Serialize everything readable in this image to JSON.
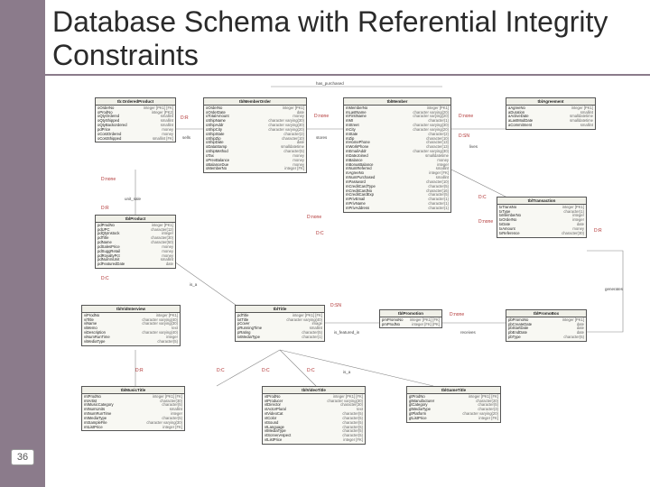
{
  "page": {
    "number": "36"
  },
  "title": "Database Schema with Referential Integrity Constraints",
  "top_rel": "has_purchased",
  "constraint_labels": [
    "D:R",
    "D:C",
    "D:SN",
    "D:none"
  ],
  "line_labels": [
    "sells",
    "is_a",
    "stores",
    "lives",
    "generates",
    "receives",
    "is_featured_in",
    "unit_sale"
  ],
  "entities": [
    {
      "name": "tb:OrderedProduct",
      "attrs": [
        [
          "oOrderNo",
          "integer [PK1] [FK]"
        ],
        [
          "oProdNo",
          "integer [PK2]"
        ],
        [
          "oQtyOrdered",
          "smallint"
        ],
        [
          "oQtyShipped",
          "smallint"
        ],
        [
          "oQtyBackordered",
          "smallint"
        ],
        [
          "pdPrice",
          "money"
        ],
        [
          "oCostOrdered",
          "money"
        ],
        [
          "oCostShipped",
          "smallint [FK]"
        ]
      ]
    },
    {
      "name": "tblMemberOrder",
      "attrs": [
        [
          "oOrderNo",
          "integer [PK1]"
        ],
        [
          "oOrderDate",
          "date"
        ],
        [
          "oTotalAmount",
          "money"
        ],
        [
          "oShipName",
          "character varying(30)"
        ],
        [
          "oShipAddr",
          "character varying(30)"
        ],
        [
          "oShipCity",
          "character varying(20)"
        ],
        [
          "oShipState",
          "character(2)"
        ],
        [
          "oShipZip",
          "character(10)"
        ],
        [
          "oShipDate",
          "date"
        ],
        [
          "oDataStamp",
          "smalldatetime"
        ],
        [
          "oShipMethod",
          "character(5)"
        ],
        [
          "oTax",
          "money"
        ],
        [
          "oPrevBalance",
          "money"
        ],
        [
          "oBalanceDue",
          "money"
        ],
        [
          "oMemberNo",
          "integer [FK]"
        ]
      ]
    },
    {
      "name": "tblMember",
      "attrs": [
        [
          "mMemberNo",
          "integer [PK1]"
        ],
        [
          "mLastName",
          "character varying(20)"
        ],
        [
          "mFirstName",
          "character varying(20)"
        ],
        [
          "mMI",
          "character(1)"
        ],
        [
          "mStreet",
          "character varying(30)"
        ],
        [
          "mCity",
          "character varying(20)"
        ],
        [
          "mState",
          "character(2)"
        ],
        [
          "mZip",
          "character(10)"
        ],
        [
          "mHomePhone",
          "character(13)"
        ],
        [
          "mWorkPhone",
          "character(13)"
        ],
        [
          "mEmailAddr",
          "character varying(30)"
        ],
        [
          "mDateJoined",
          "smalldatetime"
        ],
        [
          "mBalance",
          "money"
        ],
        [
          "mBonusBalance",
          "integer"
        ],
        [
          "mNumReferred",
          "smallint"
        ],
        [
          "mAgreeNo",
          "integer [FK]"
        ],
        [
          "mNumPurchased",
          "smallint"
        ],
        [
          "mPassword",
          "character(10)"
        ],
        [
          "mCreditCardType",
          "character(5)"
        ],
        [
          "mCreditCardNo",
          "character(16)"
        ],
        [
          "mCreditCardExp",
          "character(5)"
        ],
        [
          "mPrivEmail",
          "character(1)"
        ],
        [
          "mPrivName",
          "character(1)"
        ],
        [
          "mPrivAddress",
          "character(1)"
        ]
      ]
    },
    {
      "name": "tblAgreement",
      "attrs": [
        [
          "aAgreeNo",
          "integer [PK1]"
        ],
        [
          "aDuration",
          "smallint"
        ],
        [
          "aActiveDate",
          "smalldatetime"
        ],
        [
          "aLastModDate",
          "smalldatetime"
        ],
        [
          "aCommitment",
          "smallint"
        ]
      ]
    },
    {
      "name": "tblProduct",
      "attrs": [
        [
          "pdProdNo",
          "integer [PK1]"
        ],
        [
          "pdUPC",
          "character(12)"
        ],
        [
          "pdQtyInstock",
          "integer"
        ],
        [
          "pdTitle",
          "character(30)"
        ],
        [
          "pdName",
          "character(50)"
        ],
        [
          "pdSalesPrice",
          "money"
        ],
        [
          "pdSuggRetail",
          "money"
        ],
        [
          "pdRoyaltyPct",
          "money"
        ],
        [
          "pdNumInUnit",
          "smallint"
        ],
        [
          "pdFeaturedDate",
          "date"
        ]
      ]
    },
    {
      "name": "tblTransaction",
      "attrs": [
        [
          "txTransNo",
          "integer [PK1]"
        ],
        [
          "txType",
          "character(1)"
        ],
        [
          "txMemberNo",
          "integer"
        ],
        [
          "txOrderNo",
          "integer"
        ],
        [
          "txDate",
          "date"
        ],
        [
          "txAmount",
          "money"
        ],
        [
          "txReference",
          "character(30)"
        ]
      ]
    },
    {
      "name": "tblVidInterview",
      "attrs": [
        [
          "viProdNo",
          "integer [PK1]"
        ],
        [
          "viTitle",
          "character varying(40)"
        ],
        [
          "viName",
          "character varying(30)"
        ],
        [
          "viMemo",
          "text"
        ],
        [
          "viDescription",
          "character varying(40)"
        ],
        [
          "viNumRunTime",
          "integer"
        ],
        [
          "viMediaType",
          "character(5)"
        ]
      ]
    },
    {
      "name": "tblTitle",
      "attrs": [
        [
          "pdTitle",
          "integer [PK1] [FK]"
        ],
        [
          "txtTitle",
          "character varying(40)"
        ],
        [
          "pCover",
          "image"
        ],
        [
          "pRunningTime",
          "smallint"
        ],
        [
          "pRating",
          "character(5)"
        ],
        [
          "txtMediaType",
          "character(1)"
        ]
      ]
    },
    {
      "name": "tblPromotion",
      "attrs": [
        [
          "pmPromoNo",
          "integer [PK1] [FK]"
        ],
        [
          "pmProdNo",
          "integer [FK] [PK]"
        ]
      ]
    },
    {
      "name": "tblPromoBox",
      "attrs": [
        [
          "pbPromoNo",
          "integer [PK1]"
        ],
        [
          "pbCreateDate",
          "date"
        ],
        [
          "pbStartDate",
          "date"
        ],
        [
          "pbEndDate",
          "date"
        ],
        [
          "pbType",
          "character(5)"
        ]
      ]
    },
    {
      "name": "tblMusicTitle",
      "attrs": [
        [
          "mtProdNo",
          "integer [PK1] [FK]"
        ],
        [
          "mtArtist",
          "character(30)"
        ],
        [
          "mtMusicCategory",
          "character(5)"
        ],
        [
          "mtNumUnits",
          "smallint"
        ],
        [
          "mtNumRunTime",
          "integer"
        ],
        [
          "mtMediaType",
          "character(5)"
        ],
        [
          "mtSampleFile",
          "character varying(30)"
        ],
        [
          "mtListPrice",
          "integer [FK]"
        ]
      ]
    },
    {
      "name": "tblVideoTitle",
      "attrs": [
        [
          "vtProdNo",
          "integer [PK1] [FK]"
        ],
        [
          "vtProducer",
          "character varying(30)"
        ],
        [
          "vtDirector",
          "character(30)"
        ],
        [
          "vtActorPlural",
          "text"
        ],
        [
          "vtVideoCat",
          "character(5)"
        ],
        [
          "vtColor",
          "character(5)"
        ],
        [
          "vtSound",
          "character(5)"
        ],
        [
          "vtLanguage",
          "character(5)"
        ],
        [
          "vtMediaType",
          "character(5)"
        ],
        [
          "vtScreenAspect",
          "character(5)"
        ],
        [
          "vtListPrice",
          "integer [FK]"
        ]
      ]
    },
    {
      "name": "tblGameTitle",
      "attrs": [
        [
          "gtProdNo",
          "integer [PK1] [FK]"
        ],
        [
          "gtManufacturer",
          "character(20)"
        ],
        [
          "gtCategory",
          "character(5)"
        ],
        [
          "gtMediaType",
          "character(3)"
        ],
        [
          "gtPlatform",
          "character varying(20)"
        ],
        [
          "gtListPrice",
          "integer [FK]"
        ]
      ]
    }
  ]
}
